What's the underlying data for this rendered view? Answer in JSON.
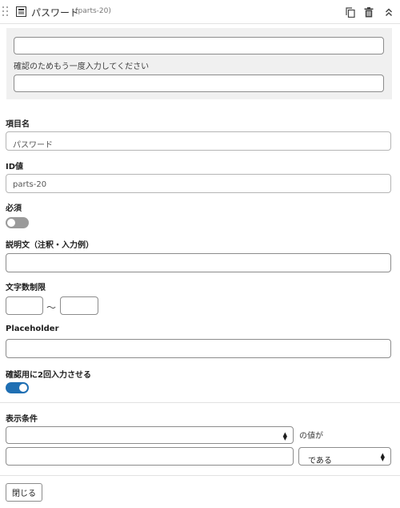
{
  "header": {
    "title": "パスワード",
    "part_id": "(parts-20)",
    "icons": [
      "drag-handle-icon",
      "password-field-icon",
      "duplicate-icon",
      "trash-icon",
      "collapse-chevron-icon"
    ]
  },
  "preview": {
    "password_value": "",
    "confirm_hint": "確認のためもう一度入力してください",
    "confirm_value": ""
  },
  "settings": {
    "item_name": {
      "label": "項目名",
      "value": "パスワード"
    },
    "id_value": {
      "label": "ID値",
      "value": "parts-20"
    },
    "required": {
      "label": "必須",
      "checked": false
    },
    "description": {
      "label": "説明文（注釈・入力例）",
      "value": ""
    },
    "char_limit": {
      "label": "文字数制限",
      "separator": "〜",
      "min": "",
      "max": ""
    },
    "placeholder": {
      "label": "Placeholder",
      "value": ""
    },
    "confirm_twice": {
      "label": "確認用に2回入力させる",
      "checked": true
    },
    "display_condition": {
      "label": "表示条件",
      "field_select": "",
      "suffix": "の値が",
      "value": "",
      "operator": "である"
    }
  },
  "footer": {
    "close_label": "閉じる"
  },
  "colors": {
    "toggle_on": "#1f6fb3",
    "toggle_off": "#9a9a9a",
    "preview_bg": "#f0f0f0"
  }
}
